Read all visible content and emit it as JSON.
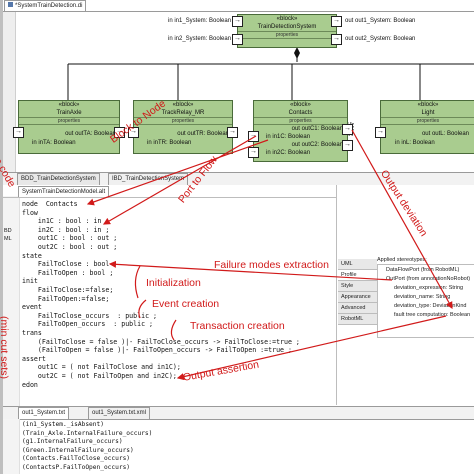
{
  "diagram_tab": "*SystemTrainDetection.di",
  "system_block": {
    "stereotype": "«block»",
    "name": "TrainDetectionSystem",
    "props": "properties",
    "in1": "in in1_System: Boolean",
    "in2": "in in2_System: Boolean",
    "out1": "out out1_System: Boolean",
    "out2": "out out2_System: Boolean"
  },
  "blocks": [
    {
      "stereotype": "«block»",
      "name": "TrainAxle",
      "props": "properties",
      "out1": "out outTA: Boolean",
      "in1": "in inTA: Boolean"
    },
    {
      "stereotype": "«block»",
      "name": "TrackRelay_MR",
      "props": "properties",
      "out1": "out outTR: Boolean",
      "in1": "in inTR: Boolean"
    },
    {
      "stereotype": "«block»",
      "name": "Contacts",
      "props": "properties",
      "out1": "out outC1: Boolean",
      "in1": "in in1C: Boolean",
      "out2": "out outC2: Boolean",
      "in2": "in in2C: Boolean"
    },
    {
      "stereotype": "«block»",
      "name": "Light",
      "props": "properties",
      "out1": "out outL: Boolean",
      "in1": "in inL: Boolean"
    }
  ],
  "editor_tabs": [
    "BDD_TrainDetectionSystem",
    "IBD_TrainDetectionSystem"
  ],
  "model_tab": "SystemTrainDetectionModel.alt",
  "code_lines": [
    "node  Contacts",
    "flow",
    "    in1C : bool : in ;",
    "    in2C : bool : in ;",
    "    out1C : bool : out ;",
    "    out2C : bool : out ;",
    "state",
    "    FailToClose : bool ;",
    "    FailToOpen : bool ;",
    "init",
    "    FailToClose:=false;",
    "    FailToOpen:=false;",
    "event",
    "    FailToClose_occurs  : public ;",
    "    FailToOpen_occurs  : public ;",
    "trans",
    "    (FailToClose = false )|- FailToClose_occurs -> FailToClose:=true ;",
    "    (FailToOpen = false )|- FailToOpen_occurs -> FailToOpen :=true ;",
    "assert",
    "    out1C = ( not FailToClose and in1C);",
    "    out2C = ( not FailToOpen and in2C);",
    "edon"
  ],
  "annotations": {
    "block_to_node": "Block to Node",
    "port_to_flow": "Port to Flow",
    "output_deviation": "Output deviation",
    "failure_modes": "Failure modes extraction",
    "initialization": "Initialization",
    "event_creation": "Event creation",
    "transaction_creation": "Transaction creation",
    "output_assertion": "Output assertion",
    "left_code": "a code",
    "min_cut_sets": "(min cut sets)"
  },
  "props_panel": {
    "tabs": [
      "UML",
      "Profile",
      "Style",
      "Appearance",
      "Advanced",
      "RobotML"
    ],
    "heading": "Applied stereotypes:",
    "items": [
      "DataFlowPort  (from RobotML)",
      "OutPort  (from annotationNoRobot)",
      "deviation_expression: String",
      "deviation_name: String",
      "deviation_type: DeviationKind",
      "fault tree computation: Boolean"
    ]
  },
  "left_gutter": [
    "BD",
    "ML"
  ],
  "output_tabs": [
    "out1_System.txt",
    "out1_System.txt.xml"
  ],
  "output_lines": [
    "(in1_System._isAbsent)",
    "(Train_Axle.InternalFailure_occurs)",
    "(g1.InternalFailure_occurs)",
    "(Green.InternalFailure_occurs)",
    "(Contacts.FailToClose_occurs)",
    "(ContactsP.FailToOpen_occurs)"
  ]
}
